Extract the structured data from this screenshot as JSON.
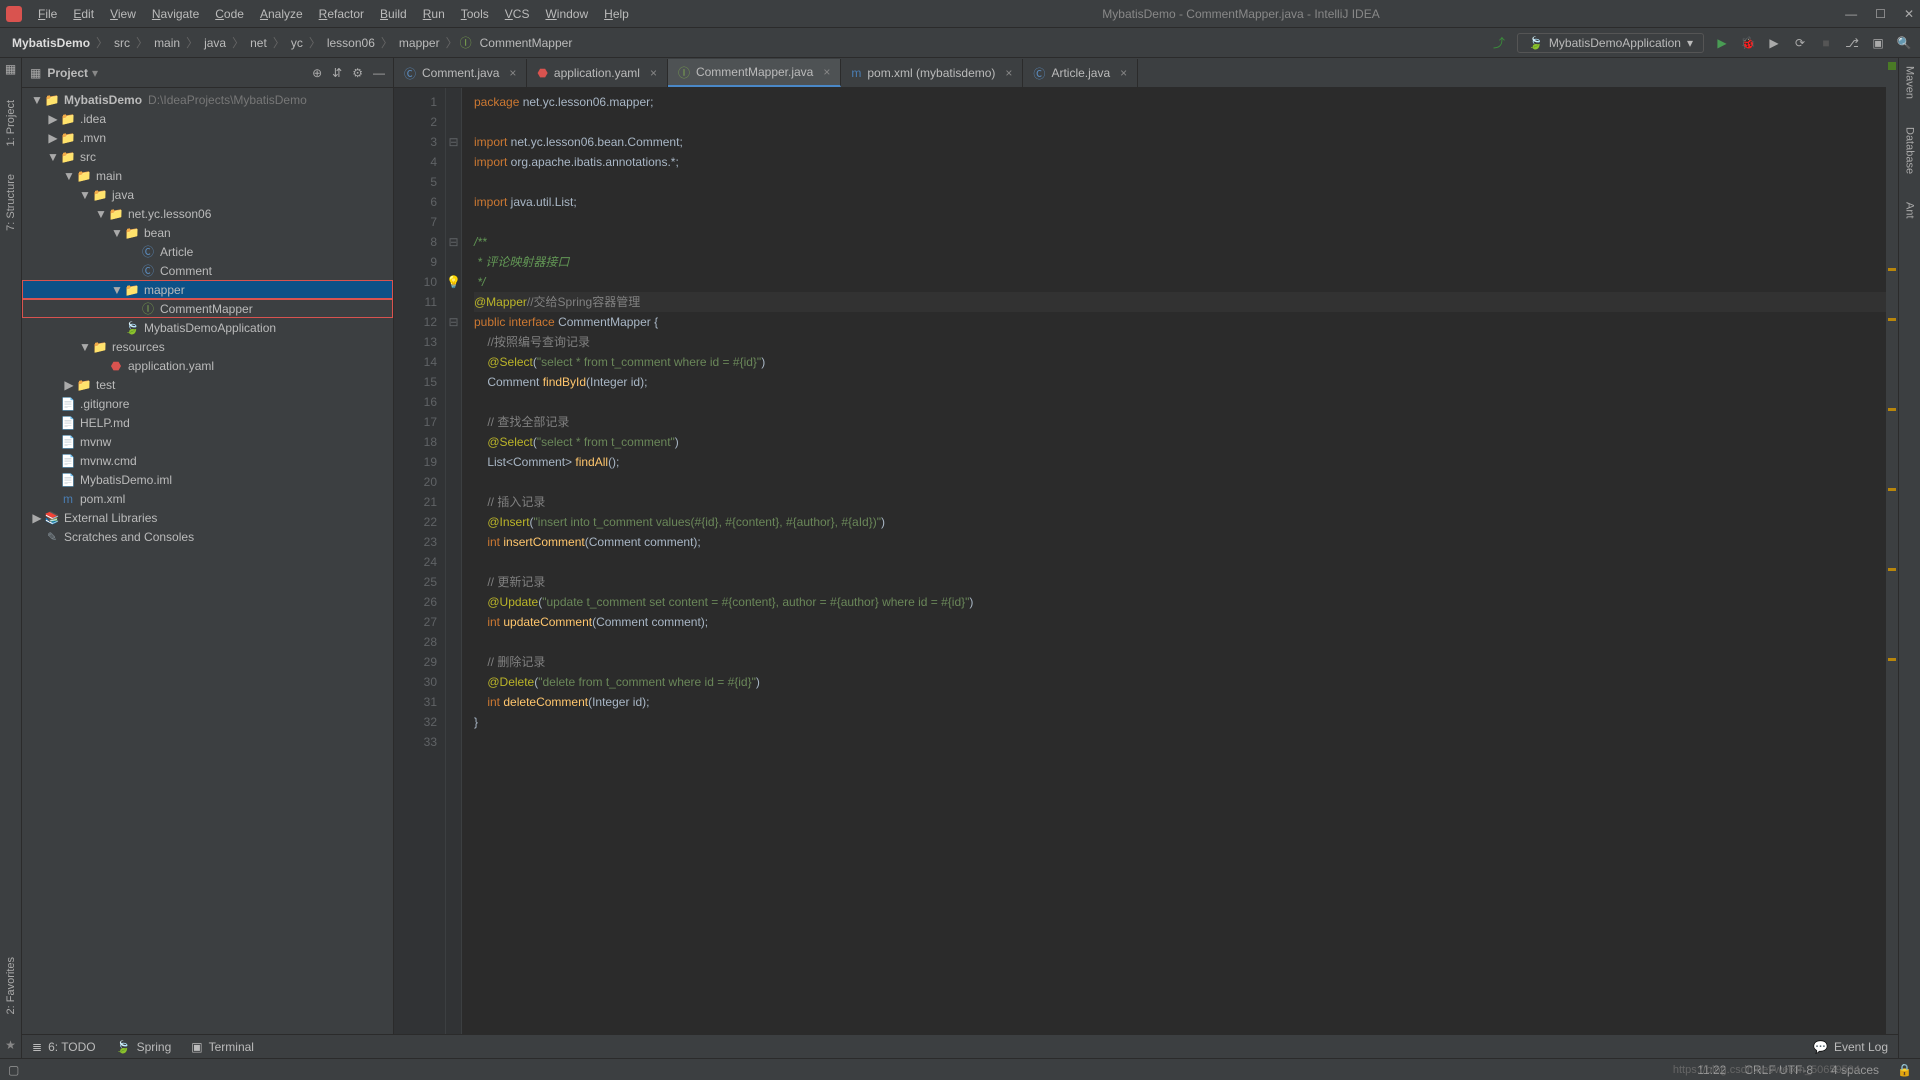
{
  "window": {
    "title": "MybatisDemo - CommentMapper.java - IntelliJ IDEA"
  },
  "menu": [
    "File",
    "Edit",
    "View",
    "Navigate",
    "Code",
    "Analyze",
    "Refactor",
    "Build",
    "Run",
    "Tools",
    "VCS",
    "Window",
    "Help"
  ],
  "breadcrumbs": [
    "MybatisDemo",
    "src",
    "main",
    "java",
    "net",
    "yc",
    "lesson06",
    "mapper",
    "CommentMapper"
  ],
  "runConfig": "MybatisDemoApplication",
  "leftStripe": [
    "1: Project",
    "7: Structure"
  ],
  "leftStripeBottom": [
    "2: Favorites"
  ],
  "rightStripe": [
    "Maven",
    "Database",
    "Ant"
  ],
  "projectPanel": {
    "title": "Project"
  },
  "tree": [
    {
      "depth": 0,
      "fold": "▼",
      "icon": "folder",
      "label": "MybatisDemo",
      "suffix": "D:\\IdeaProjects\\MybatisDemo",
      "bold": true
    },
    {
      "depth": 1,
      "fold": "▶",
      "icon": "folder",
      "label": ".idea"
    },
    {
      "depth": 1,
      "fold": "▶",
      "icon": "folder",
      "label": ".mvn"
    },
    {
      "depth": 1,
      "fold": "▼",
      "icon": "folder",
      "label": "src"
    },
    {
      "depth": 2,
      "fold": "▼",
      "icon": "folder",
      "label": "main"
    },
    {
      "depth": 3,
      "fold": "▼",
      "icon": "src-folder",
      "label": "java"
    },
    {
      "depth": 4,
      "fold": "▼",
      "icon": "pkg",
      "label": "net.yc.lesson06"
    },
    {
      "depth": 5,
      "fold": "▼",
      "icon": "pkg",
      "label": "bean"
    },
    {
      "depth": 6,
      "fold": "",
      "icon": "class",
      "label": "Article"
    },
    {
      "depth": 6,
      "fold": "",
      "icon": "class",
      "label": "Comment"
    },
    {
      "depth": 5,
      "fold": "▼",
      "icon": "pkg",
      "label": "mapper",
      "highlighted": true,
      "selected": true
    },
    {
      "depth": 6,
      "fold": "",
      "icon": "interface",
      "label": "CommentMapper",
      "highlighted": true
    },
    {
      "depth": 5,
      "fold": "",
      "icon": "spring",
      "label": "MybatisDemoApplication"
    },
    {
      "depth": 3,
      "fold": "▼",
      "icon": "res-folder",
      "label": "resources"
    },
    {
      "depth": 4,
      "fold": "",
      "icon": "yaml",
      "label": "application.yaml"
    },
    {
      "depth": 2,
      "fold": "▶",
      "icon": "folder",
      "label": "test"
    },
    {
      "depth": 1,
      "fold": "",
      "icon": "file",
      "label": ".gitignore"
    },
    {
      "depth": 1,
      "fold": "",
      "icon": "md",
      "label": "HELP.md"
    },
    {
      "depth": 1,
      "fold": "",
      "icon": "file",
      "label": "mvnw"
    },
    {
      "depth": 1,
      "fold": "",
      "icon": "file",
      "label": "mvnw.cmd"
    },
    {
      "depth": 1,
      "fold": "",
      "icon": "file",
      "label": "MybatisDemo.iml"
    },
    {
      "depth": 1,
      "fold": "",
      "icon": "maven",
      "label": "pom.xml"
    },
    {
      "depth": 0,
      "fold": "▶",
      "icon": "lib",
      "label": "External Libraries"
    },
    {
      "depth": 0,
      "fold": "",
      "icon": "scratch",
      "label": "Scratches and Consoles"
    }
  ],
  "tabs": [
    {
      "icon": "class",
      "label": "Comment.java"
    },
    {
      "icon": "yaml",
      "label": "application.yaml"
    },
    {
      "icon": "interface",
      "label": "CommentMapper.java",
      "active": true
    },
    {
      "icon": "maven",
      "label": "pom.xml (mybatisdemo)"
    },
    {
      "icon": "class",
      "label": "Article.java"
    }
  ],
  "code": {
    "lines": [
      {
        "n": 1,
        "html": "<span class='kw'>package</span> net.yc.lesson06.mapper;"
      },
      {
        "n": 2,
        "html": ""
      },
      {
        "n": 3,
        "html": "<span class='kw'>import</span> net.yc.lesson06.bean.Comment;"
      },
      {
        "n": 4,
        "html": "<span class='kw'>import</span> org.apache.ibatis.annotations.*;"
      },
      {
        "n": 5,
        "html": ""
      },
      {
        "n": 6,
        "html": "<span class='kw'>import</span> java.util.List;"
      },
      {
        "n": 7,
        "html": ""
      },
      {
        "n": 8,
        "html": "<span class='doc'>/**</span>"
      },
      {
        "n": 9,
        "html": "<span class='doc'> * 评论映射器接口</span>"
      },
      {
        "n": 10,
        "html": "<span class='doc'> */</span>"
      },
      {
        "n": 11,
        "html": "<span class='ann'>@Mapper</span><span class='cmt'>//交给Spring容器管理</span>",
        "caret": true
      },
      {
        "n": 12,
        "html": "<span class='kw'>public interface</span> <span class='cls'>CommentMapper</span> {"
      },
      {
        "n": 13,
        "html": "    <span class='cmt'>//按照编号查询记录</span>"
      },
      {
        "n": 14,
        "html": "    <span class='ann'>@Select</span>(<span class='str'>\"select * from t_comment where id = #{id}\"</span>)"
      },
      {
        "n": 15,
        "html": "    Comment <span class='mth'>findById</span>(Integer id);"
      },
      {
        "n": 16,
        "html": ""
      },
      {
        "n": 17,
        "html": "    <span class='cmt'>// 查找全部记录</span>"
      },
      {
        "n": 18,
        "html": "    <span class='ann'>@Select</span>(<span class='str'>\"select * from t_comment\"</span>)"
      },
      {
        "n": 19,
        "html": "    List&lt;Comment&gt; <span class='mth'>findAll</span>();"
      },
      {
        "n": 20,
        "html": ""
      },
      {
        "n": 21,
        "html": "    <span class='cmt'>// 插入记录</span>"
      },
      {
        "n": 22,
        "html": "    <span class='ann'>@Insert</span>(<span class='str'>\"insert into t_comment values(#{id}, #{content}, #{author}, #{aId})\"</span>)"
      },
      {
        "n": 23,
        "html": "    <span class='kw'>int</span> <span class='mth'>insertComment</span>(Comment comment);"
      },
      {
        "n": 24,
        "html": ""
      },
      {
        "n": 25,
        "html": "    <span class='cmt'>// 更新记录</span>"
      },
      {
        "n": 26,
        "html": "    <span class='ann'>@Update</span>(<span class='str'>\"update t_comment set content = #{content}, author = #{author} where id = #{id}\"</span>)"
      },
      {
        "n": 27,
        "html": "    <span class='kw'>int</span> <span class='mth'>updateComment</span>(Comment comment);"
      },
      {
        "n": 28,
        "html": ""
      },
      {
        "n": 29,
        "html": "    <span class='cmt'>// 删除记录</span>"
      },
      {
        "n": 30,
        "html": "    <span class='ann'>@Delete</span>(<span class='str'>\"delete from t_comment where id = #{id}\"</span>)"
      },
      {
        "n": 31,
        "html": "    <span class='kw'>int</span> <span class='mth'>deleteComment</span>(Integer id);"
      },
      {
        "n": 32,
        "html": "}"
      },
      {
        "n": 33,
        "html": ""
      }
    ]
  },
  "bottomTools": [
    {
      "icon": "≣",
      "label": "6: TODO"
    },
    {
      "icon": "🍃",
      "label": "Spring"
    },
    {
      "icon": "▣",
      "label": "Terminal"
    }
  ],
  "eventLog": "Event Log",
  "status": {
    "left": "",
    "pos": "11:22",
    "enc": "CRLF   UTF-8",
    "indent": "4 spaces",
    "watermark": "https://blog.csdn.net/weixin_50659534"
  }
}
